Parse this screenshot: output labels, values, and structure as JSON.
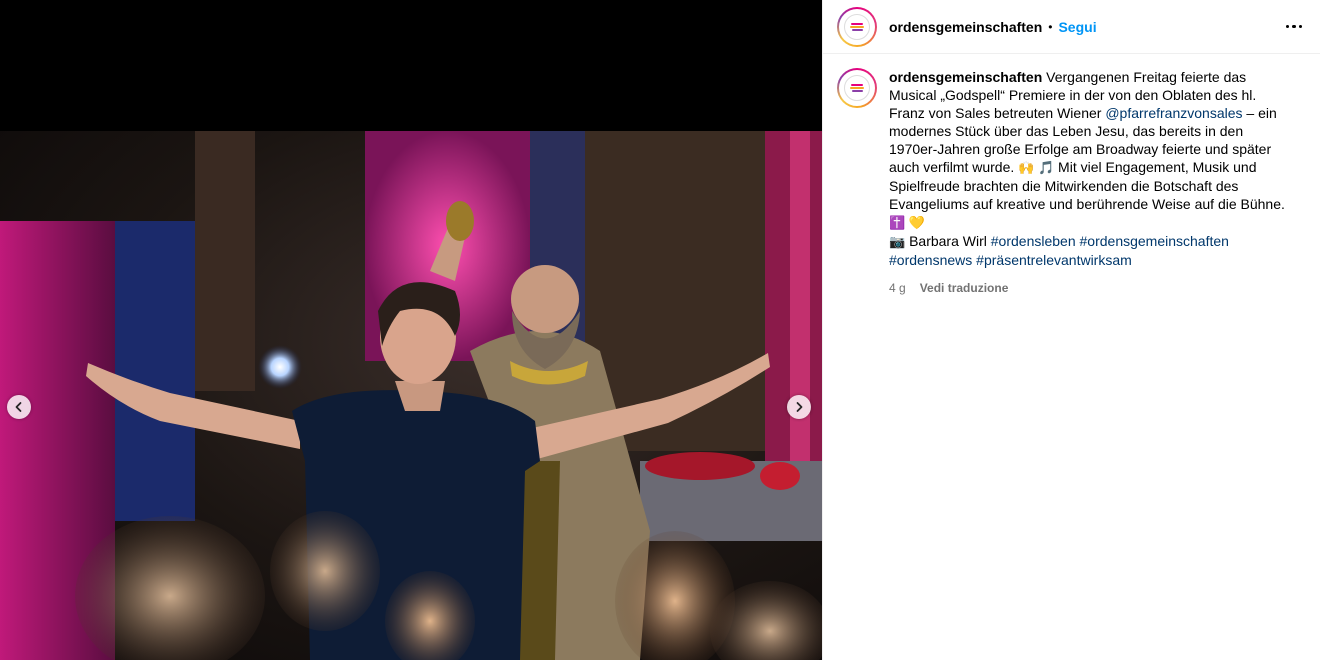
{
  "post": {
    "username": "ordensgemeinschaften",
    "separator": "•",
    "follow_label": "Segui",
    "more_icon": "more-horizontal-icon"
  },
  "media": {
    "prev_icon": "chevron-left-icon",
    "next_icon": "chevron-right-icon"
  },
  "caption": {
    "username": "ordensgemeinschaften",
    "text_1": "Vergangenen Freitag feierte das Musical „Godspell“ Premiere in der von den Oblaten des hl. Franz von Sales betreuten Wiener ",
    "mention": "@pfarrefranzvonsales",
    "text_2": " – ein modernes Stück über das Leben Jesu, das bereits in den 1970er-Jahren große Erfolge am Broadway feierte und später auch verfilmt wurde. ",
    "emoji_1": "🙌 🎵",
    "text_3": " Mit viel Engagement, Musik und Spielfreude brachten die Mitwirkenden die Botschaft des Evangeliums auf kreative und berührende Weise auf die Bühne. ",
    "emoji_2": "✝️ 💛",
    "camera_emoji": "📷",
    "credit": " Barbara Wirl ",
    "hashtags": [
      "#ordensleben",
      "#ordensgemeinschaften",
      "#ordensnews",
      "#präsentrelevantwirksam"
    ]
  },
  "meta": {
    "time": "4 g",
    "translate_label": "Vedi traduzione"
  },
  "colors": {
    "follow": "#0095f6",
    "link": "#00376b",
    "muted": "#737373",
    "avatar_ring": [
      "#e6007e",
      "#f5a623",
      "#8b3fa8"
    ]
  }
}
